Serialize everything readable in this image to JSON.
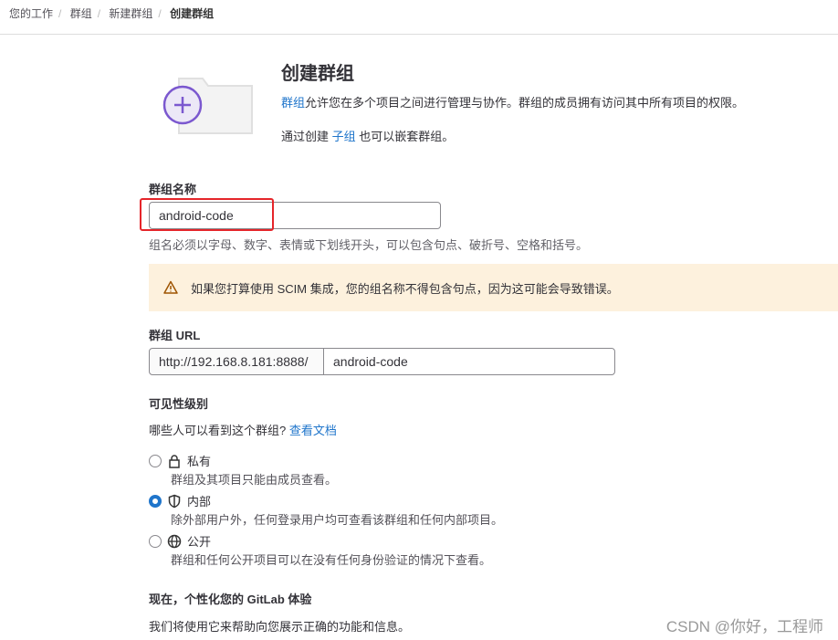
{
  "breadcrumb": [
    "您的工作",
    "群组",
    "新建群组",
    "创建群组"
  ],
  "header": {
    "title": "创建群组",
    "desc_link": "群组",
    "desc_rest": "允许您在多个项目之间进行管理与协作。群组的成员拥有访问其中所有项目的权限。",
    "nest_pre": "通过创建 ",
    "nest_link": "子组",
    "nest_post": " 也可以嵌套群组。"
  },
  "name": {
    "label": "群组名称",
    "value": "android-code",
    "help": "组名必须以字母、数字、表情或下划线开头，可以包含句点、破折号、空格和括号。"
  },
  "alert": {
    "text": "如果您打算使用 SCIM 集成，您的组名称不得包含句点，因为这可能会导致错误。"
  },
  "url": {
    "label": "群组 URL",
    "prefix": "http://192.168.8.181:8888/",
    "value": "android-code"
  },
  "visibility": {
    "label": "可见性级别",
    "question": "哪些人可以看到这个群组?",
    "doc_link": "查看文档",
    "options": [
      {
        "label": "私有",
        "desc": "群组及其项目只能由成员查看。",
        "selected": false
      },
      {
        "label": "内部",
        "desc": "除外部用户外，任何登录用户均可查看该群组和任何内部项目。",
        "selected": true
      },
      {
        "label": "公开",
        "desc": "群组和任何公开项目可以在没有任何身份验证的情况下查看。",
        "selected": false
      }
    ]
  },
  "personalize": {
    "title": "现在，个性化您的 GitLab 体验",
    "desc": "我们将使用它来帮助向您展示正确的功能和信息。"
  },
  "watermark": "CSDN @你好，工程师"
}
